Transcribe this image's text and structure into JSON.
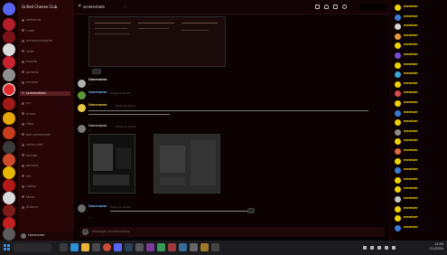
{
  "window": {
    "title": ""
  },
  "server": {
    "name": "Grilled Cheese Club"
  },
  "channels": {
    "items": [
      {
        "label": "welcome",
        "active": false
      },
      {
        "label": "rules",
        "active": false
      },
      {
        "label": "announcements",
        "active": false
      },
      {
        "label": "roles",
        "active": false
      },
      {
        "label": "events",
        "active": false
      },
      {
        "label": "general",
        "active": false
      },
      {
        "label": "memes",
        "active": false
      },
      {
        "label": "screenshots",
        "active": true
      },
      {
        "label": "art",
        "active": false
      },
      {
        "label": "music",
        "active": false
      },
      {
        "label": "clips",
        "active": false
      },
      {
        "label": "bot-commands",
        "active": false
      },
      {
        "label": "voice-chat",
        "active": false
      },
      {
        "label": "lounge",
        "active": false
      },
      {
        "label": "gaming",
        "active": false
      },
      {
        "label": "afk",
        "active": false
      },
      {
        "label": "Lobby",
        "active": false
      },
      {
        "label": "Music",
        "active": false
      },
      {
        "label": "Stream",
        "active": false
      }
    ]
  },
  "user_panel": {
    "name": "Username"
  },
  "topbar": {
    "channel": "screenshots",
    "topic": "…",
    "search_placeholder": "Search"
  },
  "messages": [
    {
      "author": "Username",
      "time": "Today at 12:00",
      "text": "…",
      "color": "#6fb2e8"
    },
    {
      "author": "Username",
      "time": "Today at 12:01",
      "text": "…",
      "color": "#e6c84a"
    },
    {
      "author": "Username",
      "time": "Today at 12:02",
      "text": "…",
      "color": "#b9b9b9"
    },
    {
      "author": "Username",
      "time": "Today at 12:04",
      "text": "…",
      "color": "#6fb2e8"
    }
  ],
  "composer": {
    "placeholder": "Message #screenshots"
  },
  "members": [
    {
      "name": "member",
      "sub": "",
      "color": "#f0d200",
      "avatar": "#f0d200"
    },
    {
      "name": "member",
      "sub": "",
      "color": "#f0d200",
      "avatar": "#3a7bd5"
    },
    {
      "name": "member",
      "sub": "",
      "color": "#f0d200",
      "avatar": "#d6d6d6"
    },
    {
      "name": "member",
      "sub": "",
      "color": "#f0d200",
      "avatar": "#e89a3a"
    },
    {
      "name": "member",
      "sub": "",
      "color": "#f0d200",
      "avatar": "#f0d200"
    },
    {
      "name": "member",
      "sub": "",
      "color": "#f0d200",
      "avatar": "#7c4ad8"
    },
    {
      "name": "member",
      "sub": "",
      "color": "#f0d200",
      "avatar": "#f0d200"
    },
    {
      "name": "member",
      "sub": "",
      "color": "#f0d200",
      "avatar": "#3aa7d5"
    },
    {
      "name": "member",
      "sub": "",
      "color": "#f0d200",
      "avatar": "#f0d200"
    },
    {
      "name": "member",
      "sub": "",
      "color": "#f0d200",
      "avatar": "#d54a4a"
    },
    {
      "name": "member",
      "sub": "",
      "color": "#f0d200",
      "avatar": "#f0d200"
    },
    {
      "name": "member",
      "sub": "",
      "color": "#f0d200",
      "avatar": "#3a7bd5"
    },
    {
      "name": "member",
      "sub": "",
      "color": "#f0d200",
      "avatar": "#f0d200"
    },
    {
      "name": "member",
      "sub": "",
      "color": "#f0d200",
      "avatar": "#8a8a8a"
    },
    {
      "name": "member",
      "sub": "",
      "color": "#f0d200",
      "avatar": "#f0d200"
    },
    {
      "name": "member",
      "sub": "",
      "color": "#f0d200",
      "avatar": "#e06a3a"
    },
    {
      "name": "member",
      "sub": "",
      "color": "#f0d200",
      "avatar": "#f0d200"
    },
    {
      "name": "member",
      "sub": "",
      "color": "#f0d200",
      "avatar": "#3a7bd5"
    },
    {
      "name": "member",
      "sub": "",
      "color": "#f0d200",
      "avatar": "#f0d200"
    },
    {
      "name": "member",
      "sub": "",
      "color": "#f0d200",
      "avatar": "#f0d200"
    },
    {
      "name": "member",
      "sub": "",
      "color": "#f0d200",
      "avatar": "#c9c9c9"
    },
    {
      "name": "member",
      "sub": "",
      "color": "#f0d200",
      "avatar": "#f0d200"
    },
    {
      "name": "member",
      "sub": "",
      "color": "#f0d200",
      "avatar": "#f0d200"
    },
    {
      "name": "member",
      "sub": "",
      "color": "#f0d200",
      "avatar": "#3a7bd5"
    }
  ],
  "taskbar": {
    "search_placeholder": "",
    "time": "12:00",
    "date": "1/1/2024"
  },
  "colors": {
    "accent": "#f0d200",
    "sidebar": "#280607",
    "active_channel": "#5a1f23",
    "windows_blue": "#3c8fe6"
  },
  "icons": {
    "rail": [
      "discord-home-icon",
      "server-icon",
      "server-icon",
      "server-icon",
      "server-icon",
      "server-icon",
      "server-icon",
      "server-icon",
      "server-icon",
      "server-icon",
      "server-icon",
      "server-icon",
      "server-icon",
      "server-icon",
      "server-icon",
      "server-icon",
      "server-icon",
      "server-icon"
    ]
  }
}
